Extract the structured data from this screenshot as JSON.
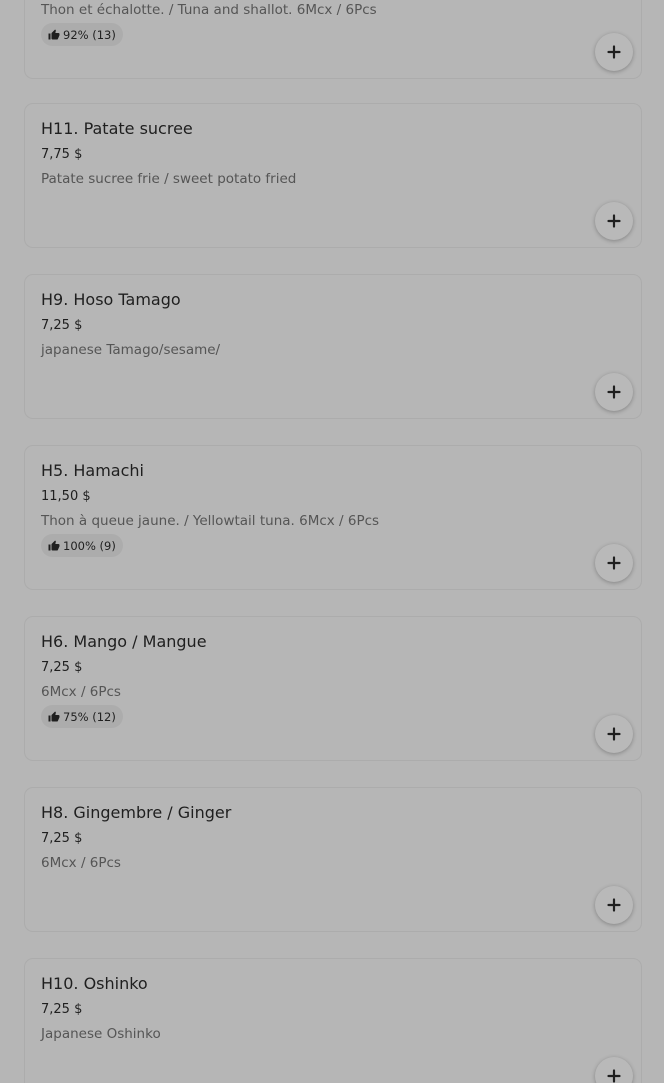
{
  "icons": {
    "add": "plus-icon",
    "rating": "thumbs-up-icon"
  },
  "items": [
    {
      "title": "",
      "price": "",
      "description": "Thon et échalotte. / Tuna and shallot. 6Mcx / 6Pcs",
      "rating": "92% (13)"
    },
    {
      "title": "H11. Patate sucree",
      "price": "7,75 $",
      "description": "Patate sucree frie / sweet potato fried",
      "rating": ""
    },
    {
      "title": "H9. Hoso Tamago",
      "price": "7,25 $",
      "description": "japanese Tamago/sesame/",
      "rating": ""
    },
    {
      "title": "H5. Hamachi",
      "price": "11,50 $",
      "description": "Thon à queue jaune. / Yellowtail tuna. 6Mcx / 6Pcs",
      "rating": "100% (9)"
    },
    {
      "title": "H6. Mango / Mangue",
      "price": "7,25 $",
      "description": "6Mcx / 6Pcs",
      "rating": "75% (12)"
    },
    {
      "title": "H8. Gingembre / Ginger",
      "price": "7,25 $",
      "description": "6Mcx / 6Pcs",
      "rating": ""
    },
    {
      "title": "H10. Oshinko",
      "price": "7,25 $",
      "description": "Japanese Oshinko",
      "rating": ""
    }
  ]
}
